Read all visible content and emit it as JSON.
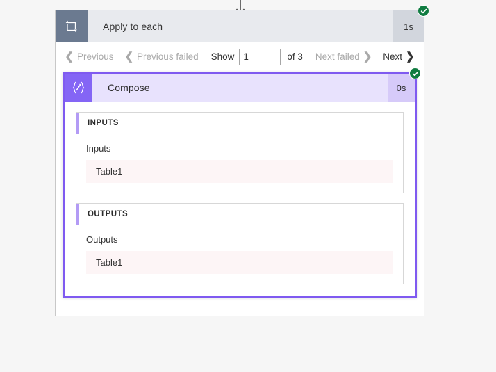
{
  "connector": {
    "icon": "arrow-down-icon"
  },
  "scope": {
    "icon": "loop-repeat-icon",
    "title": "Apply to each",
    "duration": "1s",
    "status": "succeeded",
    "status_icon": "checkmark-circle-icon",
    "status_color": "#107c41"
  },
  "pager": {
    "previous": {
      "label": "Previous",
      "chevron": "chevron-left-icon",
      "disabled": true
    },
    "previous_failed": {
      "label": "Previous failed",
      "chevron": "chevron-left-icon",
      "disabled": true
    },
    "show_label": "Show",
    "page_value": "1",
    "page_placeholder": "",
    "of_label": "of 3",
    "total_pages": 3,
    "next_failed": {
      "label": "Next failed",
      "chevron": "chevron-right-icon",
      "disabled": true
    },
    "next": {
      "label": "Next",
      "chevron": "chevron-right-icon",
      "disabled": false
    }
  },
  "compose": {
    "icon": "compose-braces-pencil-icon",
    "title": "Compose",
    "duration": "0s",
    "status": "succeeded",
    "status_icon": "checkmark-circle-icon",
    "accent_color": "#7f5af0",
    "sections": [
      {
        "heading": "INPUTS",
        "field_label": "Inputs",
        "value": "Table1"
      },
      {
        "heading": "OUTPUTS",
        "field_label": "Outputs",
        "value": "Table1"
      }
    ]
  }
}
